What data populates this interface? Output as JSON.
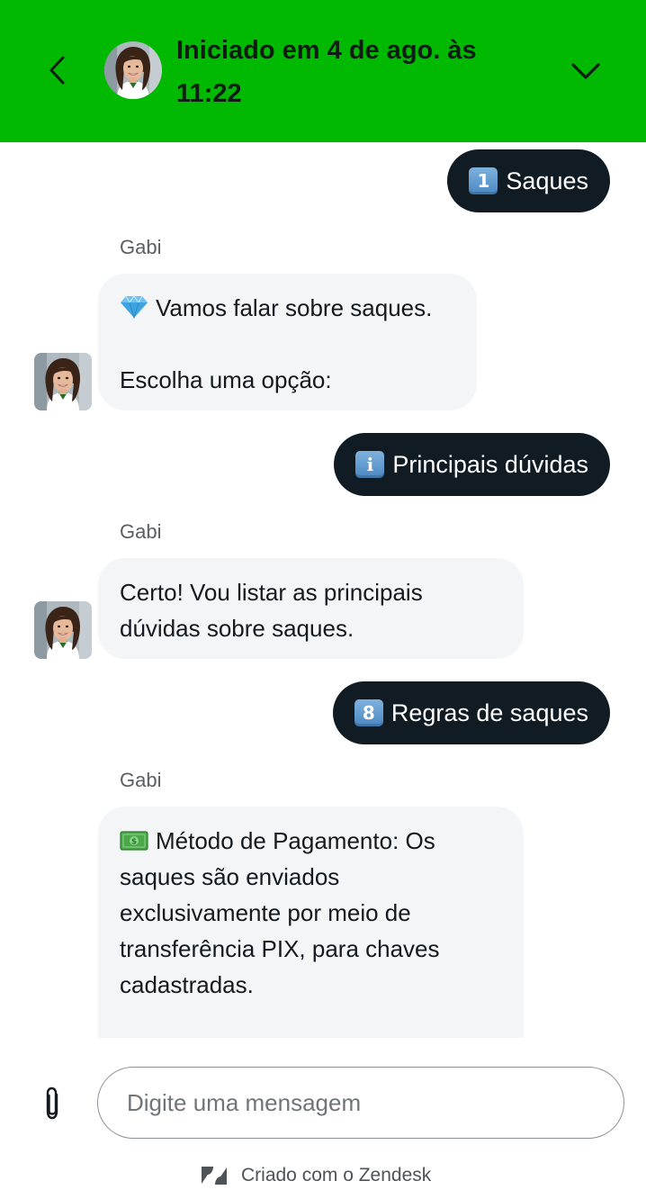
{
  "header": {
    "title": "Iniciado em 4 de ago. às 11:22",
    "back_icon": "chevron-left-icon",
    "collapse_icon": "chevron-down-icon",
    "background": "#02b902"
  },
  "messages": [
    {
      "type": "user",
      "emoji": "1",
      "text": "Saques"
    },
    {
      "type": "agent",
      "sender": "Gabi",
      "lines": [
        "Vamos falar sobre saques.",
        "",
        "Escolha uma opção:"
      ],
      "emoji": "gem-icon"
    },
    {
      "type": "user",
      "emoji": "i",
      "text": "Principais dúvidas"
    },
    {
      "type": "agent",
      "sender": "Gabi",
      "lines": [
        "Certo! Vou listar as principais",
        "dúvidas sobre saques."
      ]
    },
    {
      "type": "user",
      "emoji": "8",
      "text": "Regras de saques"
    },
    {
      "type": "agent",
      "sender": "Gabi",
      "emoji": "money-icon",
      "lines": [
        "Método de Pagamento: Os",
        "saques são enviados",
        "exclusivamente por meio de",
        "transferência PIX, para chaves",
        "cadastradas."
      ]
    }
  ],
  "composer": {
    "placeholder": "Digite uma mensagem",
    "attach_icon": "paperclip-icon"
  },
  "footer": {
    "text": "Criado com o Zendesk",
    "logo_icon": "zendesk-logo-icon"
  },
  "colors": {
    "brand_green": "#02b902",
    "user_bubble": "#101b23",
    "agent_bubble": "#f3f5f7"
  }
}
